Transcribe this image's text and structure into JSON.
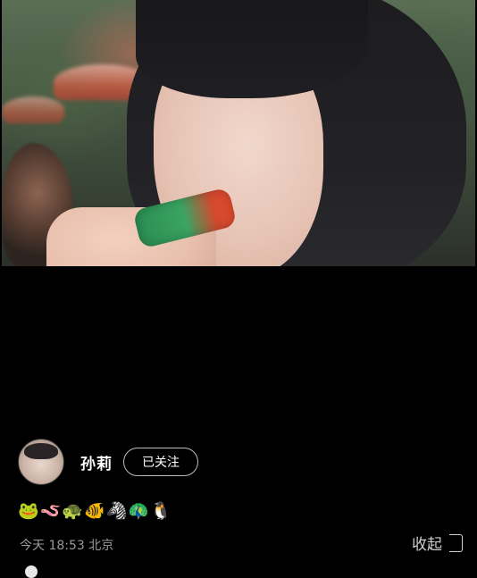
{
  "post": {
    "author": {
      "name": "孙莉",
      "follow_label": "已关注"
    },
    "caption": "🐸🪱🐢🐠🦓🦚🐧",
    "meta": "今天 18:53 北京",
    "collapse_label": "收起"
  },
  "icons": {
    "collapse": "panel-collapse-icon",
    "avatar": "user-avatar",
    "progress": "progress-dot"
  }
}
